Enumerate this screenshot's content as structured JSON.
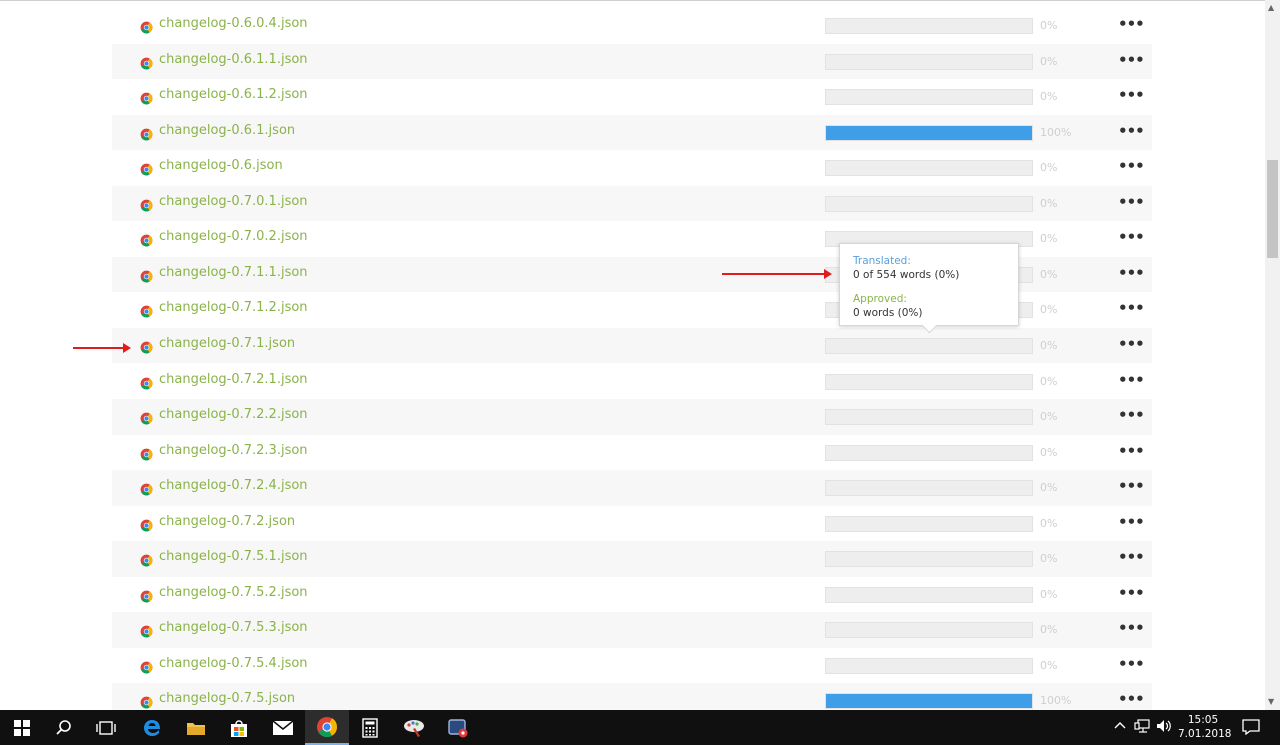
{
  "files": [
    {
      "name": "changelog-0.6.0.4.json",
      "pct": "0%",
      "progress": 0
    },
    {
      "name": "changelog-0.6.1.1.json",
      "pct": "0%",
      "progress": 0
    },
    {
      "name": "changelog-0.6.1.2.json",
      "pct": "0%",
      "progress": 0
    },
    {
      "name": "changelog-0.6.1.json",
      "pct": "100%",
      "progress": 100
    },
    {
      "name": "changelog-0.6.json",
      "pct": "0%",
      "progress": 0
    },
    {
      "name": "changelog-0.7.0.1.json",
      "pct": "0%",
      "progress": 0
    },
    {
      "name": "changelog-0.7.0.2.json",
      "pct": "0%",
      "progress": 0
    },
    {
      "name": "changelog-0.7.1.1.json",
      "pct": "0%",
      "progress": 0
    },
    {
      "name": "changelog-0.7.1.2.json",
      "pct": "0%",
      "progress": 0
    },
    {
      "name": "changelog-0.7.1.json",
      "pct": "0%",
      "progress": 0
    },
    {
      "name": "changelog-0.7.2.1.json",
      "pct": "0%",
      "progress": 0
    },
    {
      "name": "changelog-0.7.2.2.json",
      "pct": "0%",
      "progress": 0
    },
    {
      "name": "changelog-0.7.2.3.json",
      "pct": "0%",
      "progress": 0
    },
    {
      "name": "changelog-0.7.2.4.json",
      "pct": "0%",
      "progress": 0
    },
    {
      "name": "changelog-0.7.2.json",
      "pct": "0%",
      "progress": 0
    },
    {
      "name": "changelog-0.7.5.1.json",
      "pct": "0%",
      "progress": 0
    },
    {
      "name": "changelog-0.7.5.2.json",
      "pct": "0%",
      "progress": 0
    },
    {
      "name": "changelog-0.7.5.3.json",
      "pct": "0%",
      "progress": 0
    },
    {
      "name": "changelog-0.7.5.4.json",
      "pct": "0%",
      "progress": 0
    },
    {
      "name": "changelog-0.7.5.json",
      "pct": "100%",
      "progress": 100
    }
  ],
  "more_glyph": "•••",
  "tooltip": {
    "translated_label": "Translated:",
    "translated_value": "0 of 554 words (0%)",
    "approved_label": "Approved:",
    "approved_value": "0 words (0%)"
  },
  "colors": {
    "link": "#8ab34a",
    "progress_fill": "#3f9ee8",
    "annotation_arrow": "#e21b1b"
  },
  "taskbar": {
    "apps": [
      "windows-start-icon",
      "search-icon",
      "task-view-icon",
      "edge-icon",
      "file-explorer-icon",
      "store-icon",
      "mail-icon",
      "chrome-icon",
      "calculator-icon",
      "paint-icon",
      "snipping-tool-icon"
    ],
    "active_app": "chrome-icon",
    "clock_time": "15:05",
    "clock_date": "7.01.2018"
  }
}
